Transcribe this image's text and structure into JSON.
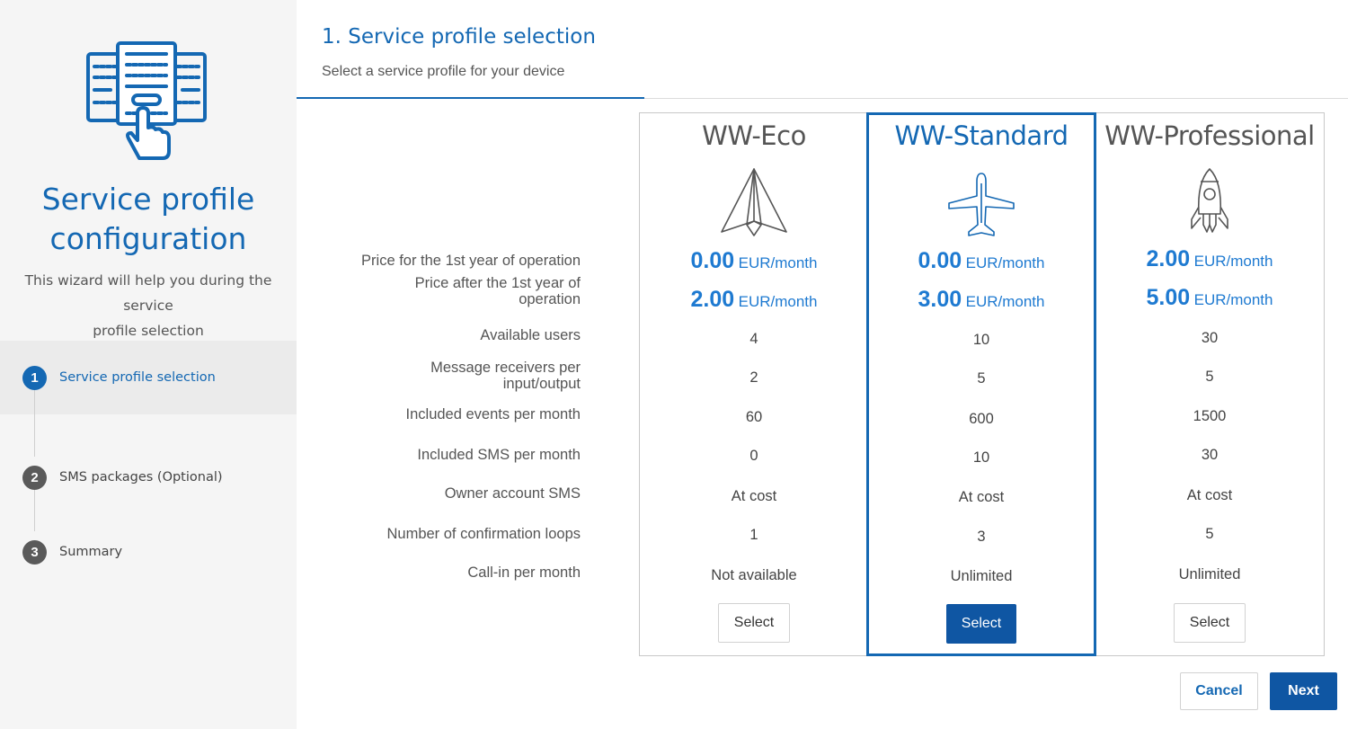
{
  "sidebar": {
    "title_line1": "Service profile",
    "title_line2": "configuration",
    "desc_line1": "This wizard will help you during the service",
    "desc_line2": "profile selection",
    "steps": [
      {
        "num": "1",
        "label": "Service profile selection",
        "active": true
      },
      {
        "num": "2",
        "label": "SMS packages (Optional)",
        "active": false
      },
      {
        "num": "3",
        "label": "Summary",
        "active": false
      }
    ]
  },
  "main": {
    "title": "1. Service profile selection",
    "subtitle": "Select a service profile for your device"
  },
  "features": {
    "price_first_year": "Price for the 1st year of operation",
    "price_after_line1": "Price after the 1st year of",
    "price_after_line2": "operation",
    "available_users": "Available users",
    "message_receivers_line1": "Message receivers per",
    "message_receivers_line2": "input/output",
    "included_events": "Included events per month",
    "included_sms": "Included SMS per month",
    "owner_sms": "Owner account SMS",
    "confirmation_loops": "Number of confirmation loops",
    "call_in": "Call-in per month"
  },
  "plans": [
    {
      "name": "WW-Eco",
      "icon": "paper-plane-icon",
      "price_first_year": "0.00",
      "price_after": "2.00",
      "unit": "EUR/month",
      "available_users": "4",
      "message_receivers": "2",
      "included_events": "60",
      "included_sms": "0",
      "owner_sms": "At cost",
      "confirmation_loops": "1",
      "call_in": "Not available",
      "select_label": "Select",
      "selected": false
    },
    {
      "name": "WW-Standard",
      "icon": "airplane-icon",
      "price_first_year": "0.00",
      "price_after": "3.00",
      "unit": "EUR/month",
      "available_users": "10",
      "message_receivers": "5",
      "included_events": "600",
      "included_sms": "10",
      "owner_sms": "At cost",
      "confirmation_loops": "3",
      "call_in": "Unlimited",
      "select_label": "Select",
      "selected": true
    },
    {
      "name": "WW-Professional",
      "icon": "rocket-icon",
      "price_first_year": "2.00",
      "price_after": "5.00",
      "unit": "EUR/month",
      "available_users": "30",
      "message_receivers": "5",
      "included_events": "1500",
      "included_sms": "30",
      "owner_sms": "At cost",
      "confirmation_loops": "5",
      "call_in": "Unlimited",
      "select_label": "Select",
      "selected": false
    }
  ],
  "footer": {
    "cancel_label": "Cancel",
    "next_label": "Next"
  },
  "colors": {
    "accent": "#1468b3",
    "primary_button": "#0f56a3",
    "price": "#1e7ad1"
  }
}
